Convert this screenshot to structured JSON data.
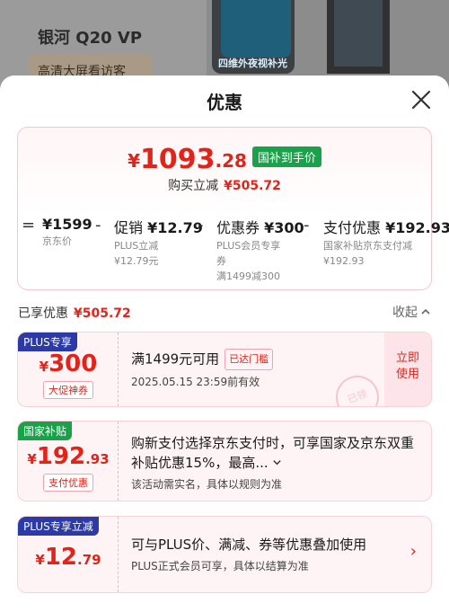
{
  "background": {
    "product_title": "银河 Q20 VP",
    "product_tag": "高清大屏看访客",
    "phone_screen_text": "四维外夜视补光"
  },
  "sheet": {
    "title": "优惠",
    "close_icon": "close-icon"
  },
  "summary": {
    "price_yen": "¥",
    "price_int": "1093",
    "price_dec": ".28",
    "price_tag": "国补到手价",
    "instant_reduce_label": "购买立减",
    "instant_reduce_value": "¥505.72",
    "breakdown": [
      {
        "op": "=",
        "main_label": "",
        "main_value": "¥1599",
        "sub": [
          "京东价"
        ]
      },
      {
        "op": "-",
        "main_label": "促销",
        "main_value": "¥12.79",
        "sub": [
          "PLUS立减",
          "¥12.79元"
        ]
      },
      {
        "op": "-",
        "main_label": "优惠券",
        "main_value": "¥300",
        "sub": [
          "PLUS会员专享",
          "券",
          "满1499减300"
        ]
      },
      {
        "op": "-",
        "main_label": "支付优惠",
        "main_value": "¥192.93",
        "sub": [
          "国家补贴京东支付减",
          "¥192.93"
        ]
      }
    ]
  },
  "saved": {
    "label": "已享优惠",
    "value": "¥505.72",
    "collapse_label": "收起"
  },
  "coupons": [
    {
      "badge": "PLUS专享",
      "yen": "¥",
      "amount": "300",
      "amount_dec": "",
      "label": "大促神券",
      "title": "满1499元可用",
      "title_tag": "已达门槛",
      "note": "2025.05.15 23:59前有效",
      "action": "立即使用",
      "stamp": "已领"
    },
    {
      "badge": "国家补贴",
      "yen": "¥",
      "amount": "192",
      "amount_dec": ".93",
      "label": "支付优惠",
      "title": "购新支付选择京东支付时，可享国家及京东双重补贴优惠15%，最高...",
      "note": "该活动需实名，具体以规则为准"
    },
    {
      "badge": "PLUS专享立减",
      "yen": "¥",
      "amount": "12",
      "amount_dec": ".79",
      "title": "可与PLUS价、满减、券等优惠叠加使用",
      "note": "PLUS正式会员可享，具体以结算为准"
    }
  ],
  "colors": {
    "accent_red": "#e2231a",
    "plus_blue": "#2b3aa6",
    "subsidy_green": "#1aa24a"
  }
}
